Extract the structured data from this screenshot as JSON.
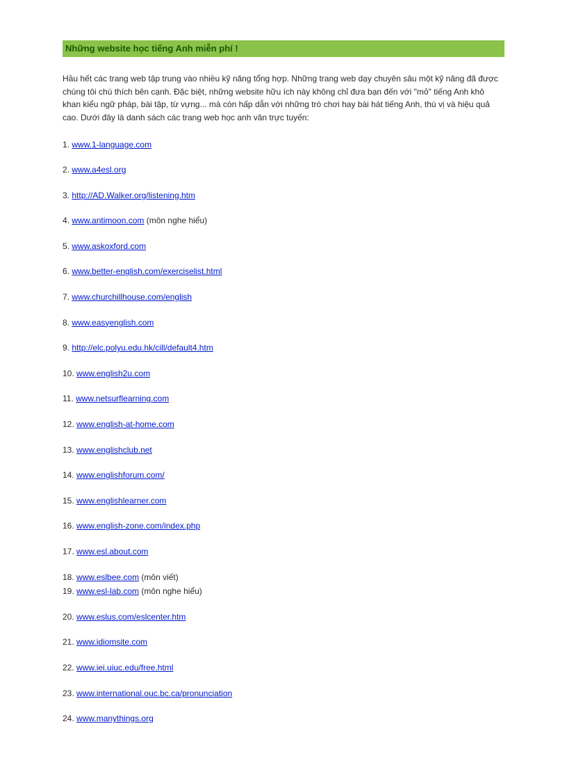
{
  "title": "Những website học tiếng Anh miễn phí !",
  "intro": "Hầu hết các trang web tập trung vào nhiều kỹ năng tổng hợp. Những trang web dạy chuyên sâu một kỹ năng đã được chúng tôi chú thích bên cạnh. Đặc biệt, những website hữu ích này không chỉ đưa bạn đến với \"mỏ\" tiếng Anh khô khan kiểu ngữ pháp, bài tập, từ vựng... mà còn hấp dẫn với những trò chơi hay bài hát tiếng Anh, thú vị và hiệu quả cao. Dưới đây là danh sách các trang web học anh văn trực tuyến:",
  "items": [
    {
      "n": "1",
      "url": "www.1-language.com",
      "annot": ""
    },
    {
      "n": "2",
      "url": "www.a4esl.org",
      "annot": ""
    },
    {
      "n": "3",
      "url": "http://AD.Walker.org/listening.htm",
      "annot": ""
    },
    {
      "n": "4",
      "url": "www.antimoon.com",
      "annot": " (môn nghe hiểu)"
    },
    {
      "n": "5",
      "url": "www.askoxford.com",
      "annot": ""
    },
    {
      "n": "6",
      "url": "www.better-english.com/exerciselist.html",
      "annot": ""
    },
    {
      "n": "7",
      "url": "www.churchillhouse.com/english",
      "annot": ""
    },
    {
      "n": "8",
      "url": "www.easyenglish.com",
      "annot": ""
    },
    {
      "n": "9",
      "url": "http://elc.polyu.edu.hk/cill/default4.htm",
      "annot": ""
    },
    {
      "n": "10",
      "url": "www.english2u.com",
      "annot": ""
    },
    {
      "n": "11",
      "url": "www.netsurflearning.com",
      "annot": ""
    },
    {
      "n": "12",
      "url": "www.english-at-home.com",
      "annot": ""
    },
    {
      "n": "13",
      "url": "www.englishclub.net",
      "annot": ""
    },
    {
      "n": "14",
      "url": "www.englishforum.com/",
      "annot": ""
    },
    {
      "n": "15",
      "url": "www.englishlearner.com",
      "annot": ""
    },
    {
      "n": "16",
      "url": "www.english-zone.com/index.php",
      "annot": ""
    },
    {
      "n": "17",
      "url": "www.esl.about.com",
      "annot": ""
    },
    {
      "n": "18",
      "url": "www.eslbee.com",
      "annot": " (môn viết)"
    },
    {
      "n": "19",
      "url": "www.esl-lab.com",
      "annot": " (môn nghe hiểu)"
    },
    {
      "n": "20",
      "url": "www.eslus.com/eslcenter.htm",
      "annot": ""
    },
    {
      "n": "21",
      "url": "www.idiomsite.com",
      "annot": ""
    },
    {
      "n": "22",
      "url": "www.iei.uiuc.edu/free.html",
      "annot": ""
    },
    {
      "n": "23",
      "url": "www.international.ouc.bc.ca/pronunciation",
      "annot": ""
    },
    {
      "n": "24",
      "url": "www.manythings.org",
      "annot": ""
    }
  ]
}
